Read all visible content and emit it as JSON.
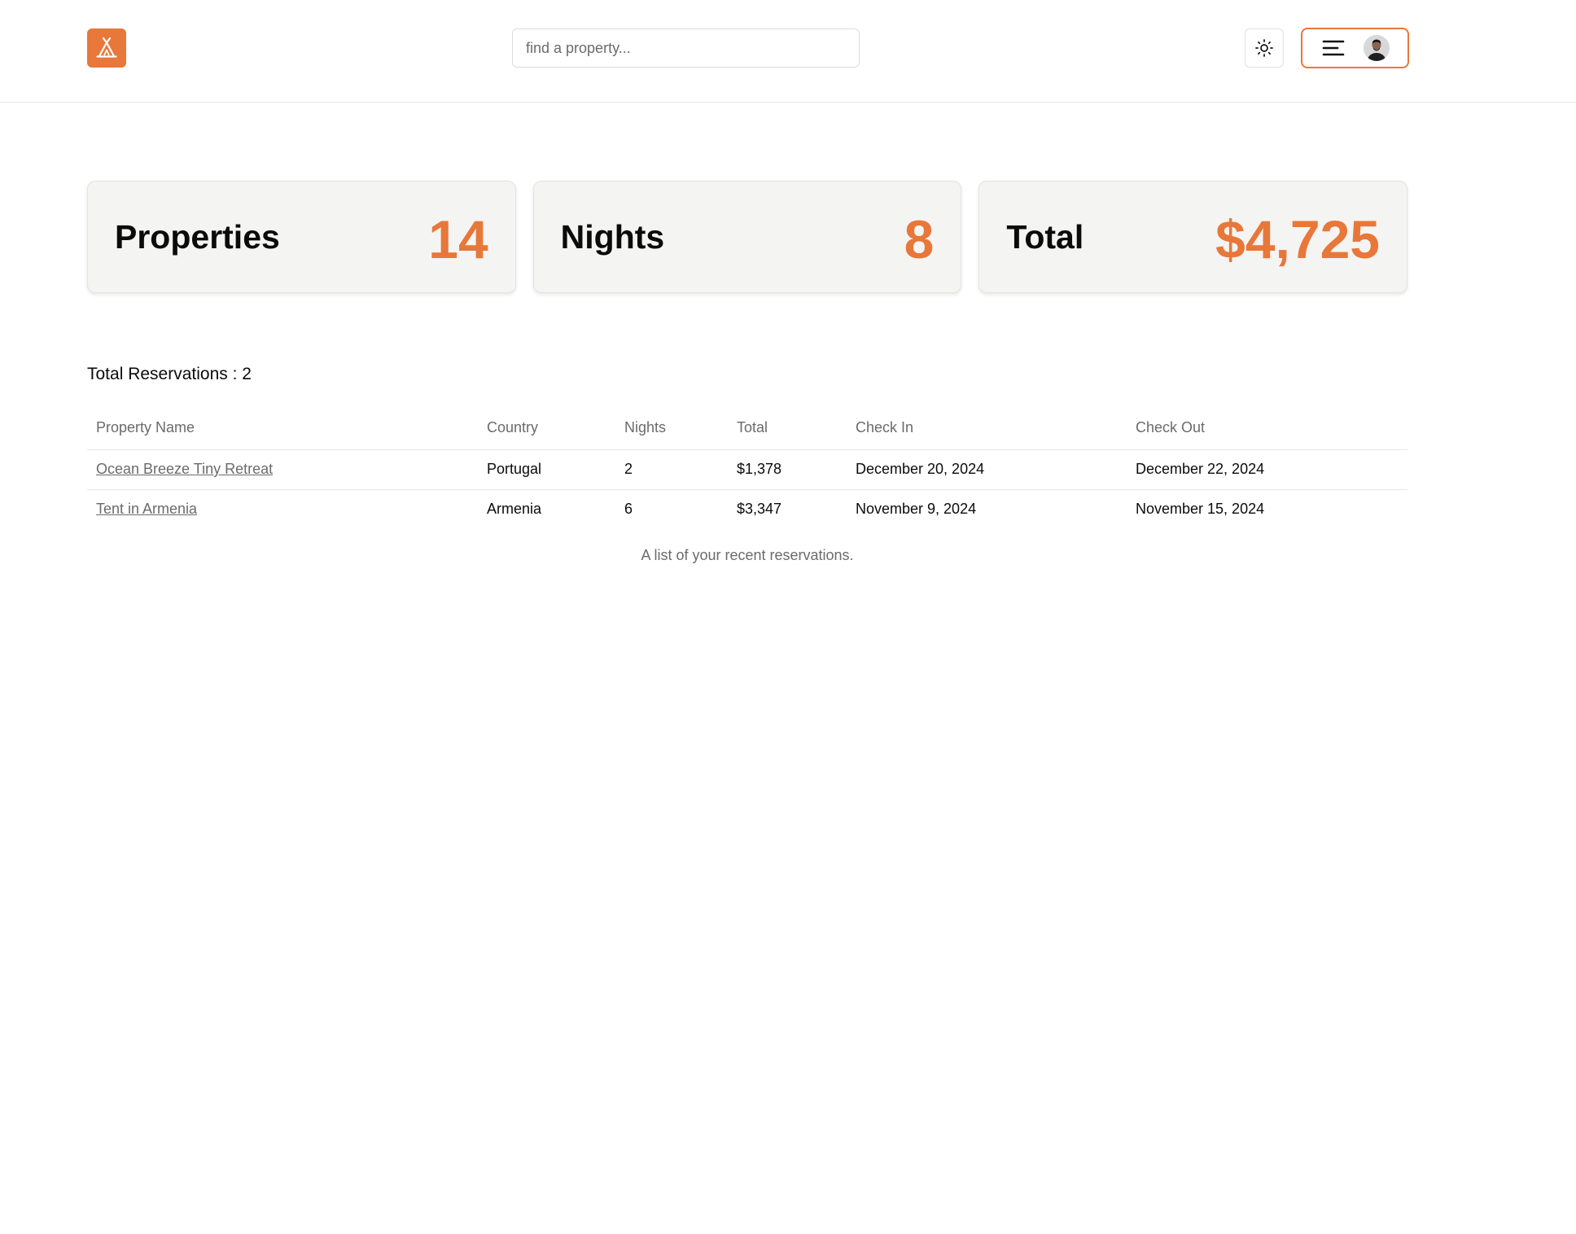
{
  "app": {
    "accent_color": "#e8773a",
    "logo_icon": "tent-icon"
  },
  "header": {
    "search_placeholder": "find a property...",
    "theme_toggle_icon": "sun-icon",
    "menu_icon": "hamburger-menu-icon",
    "avatar_icon": "user-avatar"
  },
  "stats": [
    {
      "label": "Properties",
      "value": "14"
    },
    {
      "label": "Nights",
      "value": "8"
    },
    {
      "label": "Total",
      "value": "$4,725"
    }
  ],
  "reservations": {
    "title": "Total Reservations : 2",
    "columns": [
      "Property Name",
      "Country",
      "Nights",
      "Total",
      "Check In",
      "Check Out"
    ],
    "rows": [
      {
        "property": "Ocean Breeze Tiny Retreat",
        "country": "Portugal",
        "nights": "2",
        "total": "$1,378",
        "check_in": "December 20, 2024",
        "check_out": "December 22, 2024"
      },
      {
        "property": "Tent in Armenia",
        "country": "Armenia",
        "nights": "6",
        "total": "$3,347",
        "check_in": "November 9, 2024",
        "check_out": "November 15, 2024"
      }
    ],
    "caption": "A list of your recent reservations."
  }
}
